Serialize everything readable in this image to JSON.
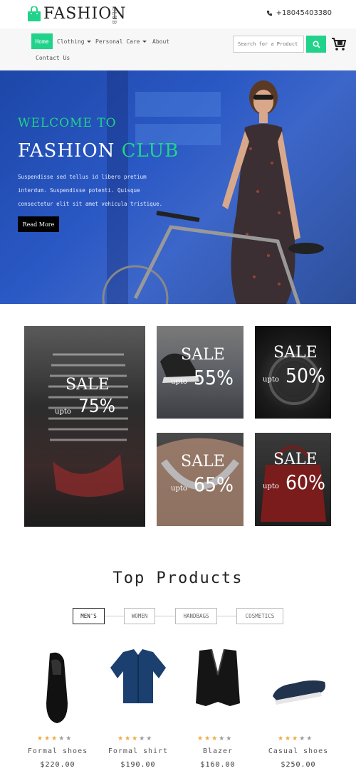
{
  "brand": {
    "logo_text": "FASHION",
    "logo_sub": "CLUB",
    "accent_color": "#21d38a"
  },
  "contact": {
    "phone": "+18045403380"
  },
  "nav": {
    "items": [
      {
        "label": "Home",
        "active": true
      },
      {
        "label": "Clothing",
        "dropdown": true
      },
      {
        "label": "Personal Care",
        "dropdown": true
      },
      {
        "label": "About"
      },
      {
        "label": "Contact Us"
      }
    ],
    "search_placeholder": "Search for a Product"
  },
  "hero": {
    "welcome": "WELCOME TO",
    "title_main": "FASHION",
    "title_accent": "CLUB",
    "description": "Suspendisse sed tellus id libero pretium interdum. Suspendisse potenti. Quisque consectetur elit sit amet vehicula tristique.",
    "button_label": "Read More"
  },
  "sales": [
    {
      "sale": "SALE",
      "upto": "upto",
      "percent": "75%"
    },
    {
      "sale": "SALE",
      "upto": "upto",
      "percent": "55%"
    },
    {
      "sale": "SALE",
      "upto": "upto",
      "percent": "50%"
    },
    {
      "sale": "SALE",
      "upto": "upto",
      "percent": "65%"
    },
    {
      "sale": "SALE",
      "upto": "upto",
      "percent": "60%"
    }
  ],
  "top_products": {
    "title": "Top Products",
    "tabs": [
      "MEN'S",
      "WOMEN",
      "HANDBAGS",
      "COSMETICS"
    ],
    "active_tab": "MEN'S",
    "items": [
      {
        "name": "Formal shoes",
        "price": "$220.00",
        "rating": 3,
        "max_rating": 5
      },
      {
        "name": "Formal shirt",
        "price": "$190.00",
        "rating": 3,
        "max_rating": 5
      },
      {
        "name": "Blazer",
        "price": "$160.00",
        "rating": 3,
        "max_rating": 5
      },
      {
        "name": "Casual shoes",
        "price": "$250.00",
        "rating": 3,
        "max_rating": 5
      }
    ]
  },
  "icons": {
    "logo": "shopping-bag-icon",
    "phone": "phone-icon",
    "search": "search-icon",
    "cart": "cart-icon",
    "dropdown": "caret-down-icon",
    "rating": "star-icon"
  }
}
